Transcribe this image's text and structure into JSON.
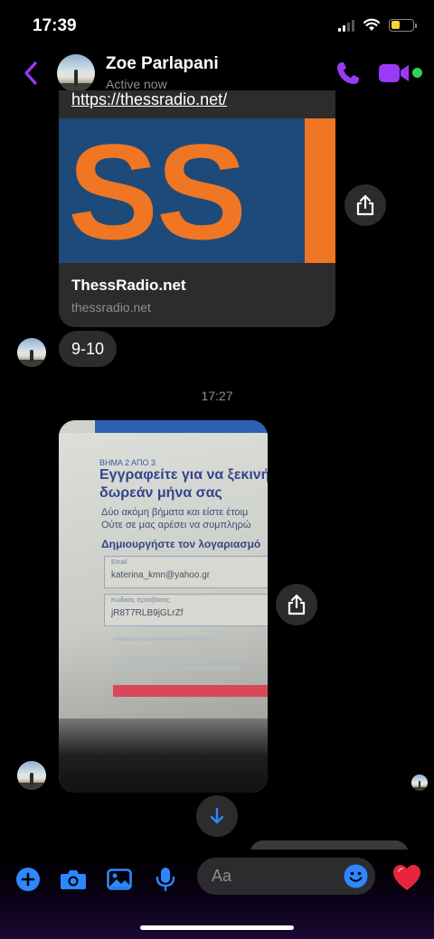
{
  "status_bar": {
    "time": "17:39",
    "battery_level": 0.4
  },
  "header": {
    "contact_name": "Zoe Parlapani",
    "contact_status": "Active now",
    "accent_color": "#9b39f5",
    "online_color": "#31d158",
    "icons": [
      "chevron-left-icon",
      "phone-icon",
      "video-camera-icon"
    ]
  },
  "link_card": {
    "url": "https://thessradio.net/",
    "image_text": "SS",
    "title": "ThessRadio.net",
    "domain": "thessradio.net"
  },
  "messages": [
    {
      "text": "9-10",
      "from": "contact"
    }
  ],
  "timestamp": "17:27",
  "photo": {
    "step": "ΒΗΜΑ 2 ΑΠΟ 3",
    "heading_line1": "Εγγραφείτε για να ξεκινήσ",
    "heading_line2": "δωρεάν μήνα σας",
    "para_line1": "Δύο ακόμη βήματα και είστε έτοιμ",
    "para_line2": "Ούτε σε μας αρέσει να συμπληρώ",
    "subheading": "Δημιουργήστε τον λογαριασμό",
    "email_label": "Email",
    "email_value": "katerina_kmn@yahoo.gr",
    "password_label": "Κωδικός πρόσβασης",
    "password_value": "jR8T7RLB9jGLrZf"
  },
  "composer": {
    "placeholder": "Aa",
    "icons": [
      "plus-icon",
      "camera-icon",
      "gallery-icon",
      "microphone-icon",
      "emoji-icon",
      "heart-icon"
    ],
    "accent_color": "#2d88ff"
  }
}
